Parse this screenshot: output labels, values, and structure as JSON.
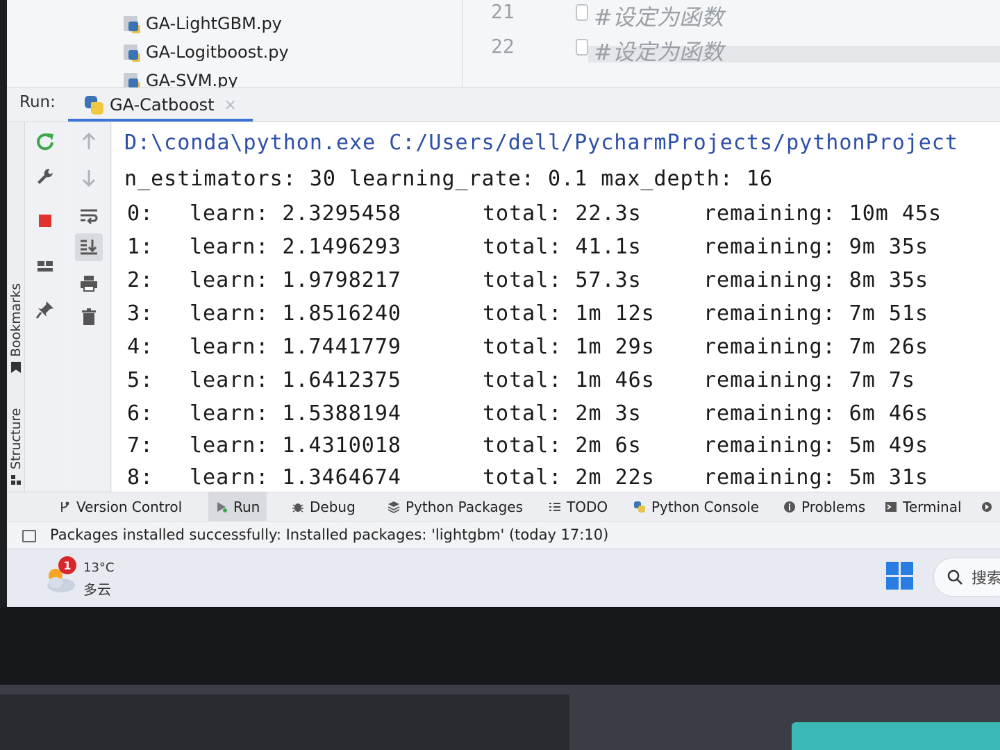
{
  "project_tree": {
    "items": [
      {
        "label": "GA-LightGBM.py"
      },
      {
        "label": "GA-Logitboost.py"
      },
      {
        "label": "GA-SVM.py"
      }
    ]
  },
  "editor": {
    "lines": [
      {
        "number": "21",
        "text": "#设定为函数"
      },
      {
        "number": "22",
        "text": "#设定为函数"
      }
    ]
  },
  "run_window": {
    "label": "Run:",
    "tab": {
      "name": "GA-Catboost",
      "close": "×"
    }
  },
  "side_tabs": {
    "bookmarks": "Bookmarks",
    "structure": "Structure"
  },
  "console": {
    "command": "D:\\conda\\python.exe C:/Users/dell/PycharmProjects/pythonProject",
    "params": "n_estimators: 30 learning_rate: 0.1 max_depth: 16",
    "iterations": [
      {
        "idx": "0:",
        "learn": "learn: 2.3295458",
        "total": "total: 22.3s",
        "remaining": "remaining: 10m 45s"
      },
      {
        "idx": "1:",
        "learn": "learn: 2.1496293",
        "total": "total: 41.1s",
        "remaining": "remaining: 9m 35s"
      },
      {
        "idx": "2:",
        "learn": "learn: 1.9798217",
        "total": "total: 57.3s",
        "remaining": "remaining: 8m 35s"
      },
      {
        "idx": "3:",
        "learn": "learn: 1.8516240",
        "total": "total: 1m 12s",
        "remaining": "remaining: 7m 51s"
      },
      {
        "idx": "4:",
        "learn": "learn: 1.7441779",
        "total": "total: 1m 29s",
        "remaining": "remaining: 7m 26s"
      },
      {
        "idx": "5:",
        "learn": "learn: 1.6412375",
        "total": "total: 1m 46s",
        "remaining": "remaining: 7m 7s"
      },
      {
        "idx": "6:",
        "learn": "learn: 1.5388194",
        "total": "total: 2m 3s",
        "remaining": "remaining: 6m 46s"
      },
      {
        "idx": "7:",
        "learn": "learn: 1.4310018",
        "total": "total: 2m 6s",
        "remaining": "remaining: 5m 49s"
      },
      {
        "idx": "8:",
        "learn": "learn: 1.3464674",
        "total": "total: 2m 22s",
        "remaining": "remaining: 5m 31s"
      }
    ]
  },
  "bottom_bar": {
    "items": [
      {
        "label": "Version Control",
        "icon": "version-control-icon"
      },
      {
        "label": "Run",
        "icon": "run-icon",
        "active": true
      },
      {
        "label": "Debug",
        "icon": "bug-icon"
      },
      {
        "label": "Python Packages",
        "icon": "packages-icon"
      },
      {
        "label": "TODO",
        "icon": "list-icon"
      },
      {
        "label": "Python Console",
        "icon": "python-icon"
      },
      {
        "label": "Problems",
        "icon": "info-icon"
      },
      {
        "label": "Terminal",
        "icon": "terminal-icon"
      }
    ]
  },
  "status_bar": {
    "message": "Packages installed successfully: Installed packages: 'lightgbm' (today 17:10)"
  },
  "taskbar": {
    "weather_badge": "1",
    "temperature": "13°C",
    "condition": "多云",
    "search_text": "搜索"
  },
  "colors": {
    "accent": "#3b74d8",
    "rerun_green": "#3fa64a",
    "stop_red": "#e0322e",
    "console_path": "#2d4fa8"
  }
}
